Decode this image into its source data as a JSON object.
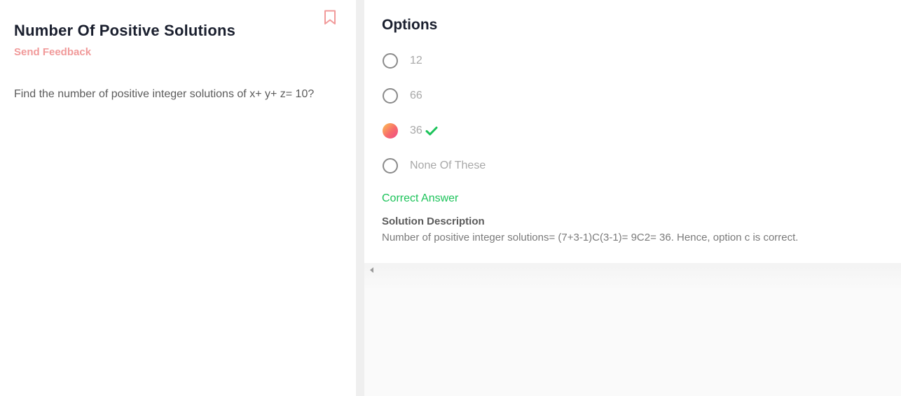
{
  "question": {
    "title": "Number Of Positive Solutions",
    "feedback_label": "Send Feedback",
    "text": "Find the number of positive integer solutions of x+ y+ z= 10?"
  },
  "icons": {
    "bookmark": "bookmark-icon",
    "check": "check-icon",
    "scroll_left": "chevron-left-icon"
  },
  "options": {
    "heading": "Options",
    "items": [
      {
        "label": "12",
        "selected": false
      },
      {
        "label": "66",
        "selected": false
      },
      {
        "label": "36",
        "selected": true,
        "correct": true
      },
      {
        "label": "None Of These",
        "selected": false
      }
    ]
  },
  "result": {
    "status": "Correct Answer"
  },
  "solution": {
    "heading": "Solution Description",
    "text": "Number of positive integer solutions= (7+3-1)C(3-1)= 9C2= 36. Hence, option c is correct."
  },
  "colors": {
    "accent_pink": "#f19a9a",
    "correct_green": "#1cc35a",
    "title_dark": "#1a1f2e"
  }
}
